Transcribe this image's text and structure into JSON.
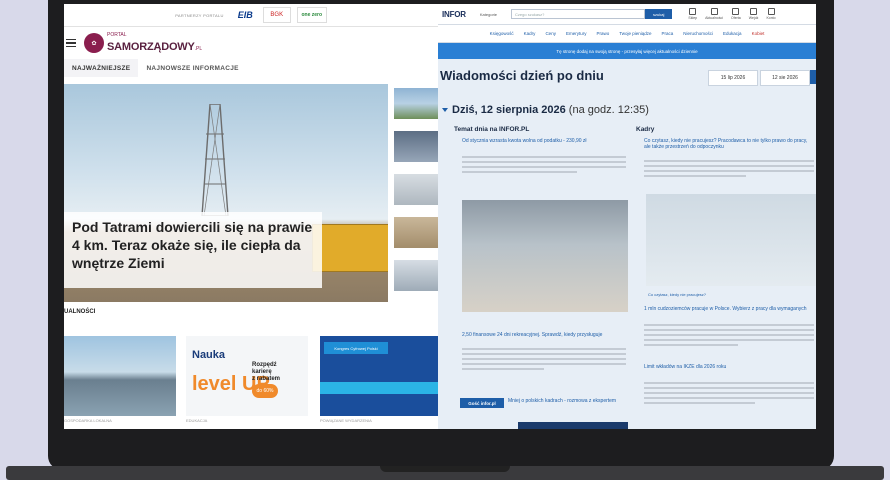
{
  "left_portal": {
    "ad_strip": {
      "label": "PARTNERZY PORTALU",
      "logos": [
        "EIB",
        "BGK",
        "one zero"
      ]
    },
    "brand": {
      "small": "PORTAL",
      "name": "SAMORZĄDOWY",
      "suffix": ".PL"
    },
    "tabs": [
      "NAJWAŻNIEJSZE",
      "NAJNOWSZE INFORMACJE"
    ],
    "hero_headline": "Pod Tatrami dowiercili się na prawie 4 km. Teraz okaże się, ile ciepła da wnętrze Ziemi",
    "section_label": "UALNOŚCI",
    "cards": [
      {
        "tag": "GOSPODARKA LOKALNA"
      },
      {
        "tag": "EDUKACJA",
        "title": "Nauka",
        "subtitle": "level UP",
        "badge_line1": "Rozpędź",
        "badge_line2": "karierę",
        "badge_line3": "z rabatem",
        "badge_pct": "do 60%"
      },
      {
        "tag": "POWIĄZANE WYDARZENIA",
        "band": "Kongres Cyfrowej Polski"
      }
    ]
  },
  "right_portal": {
    "logo": "INFOR",
    "catalog_label": "Kategorie",
    "search_placeholder": "Czego szukasz?",
    "search_button": "szukaj",
    "icons": [
      {
        "name": "phone-icon",
        "label": "Sklep"
      },
      {
        "name": "doc-icon",
        "label": "Aktualności"
      },
      {
        "name": "gift-icon",
        "label": "Oferta"
      },
      {
        "name": "book-icon",
        "label": "Wejdź"
      },
      {
        "name": "user-icon",
        "label": "Konto"
      }
    ],
    "nav": [
      "Księgowość",
      "Kadry",
      "Ceny",
      "Emerytury",
      "Prawo",
      "Twoje pieniądze",
      "Praca",
      "Nieruchomości",
      "Edukacja",
      "Kobiet"
    ],
    "banner": "Tę stronę dodaj na swoją stronę - przesyłaj więcej aktualności dziennie",
    "heading": "Wiadomości dzień po dniu",
    "date_from": "15 lip 2026",
    "date_to": "12 sie 2026",
    "today": "Dziś, 12 sierpnia 2026",
    "today_note": "(na godz. 12:35)",
    "col_left_title": "Temat dnia na INFOR.PL",
    "col_right_title": "Kadry",
    "left_link1": "Od stycznia wzrasta kwota wolna od podatku - 230,90 zł",
    "left_link2": "2,50 finansowe 24 dni rekreacyjnej. Sprawdź, kiedy przysługuje",
    "right_link1": "Co czytasz, kiedy nie pracujesz? Pracodawca to nie tylko prawo do pracy, ale także przestrzeń do odpoczynku",
    "right_caption": "Co czytasz, kiedy nie pracujesz?",
    "right_link2": "1 mln cudzoziemców pracuje w Polsce. Wybierz z pracy dla wymaganych",
    "right_link3": "Limit wkładów na IKZE dla 2026 roku",
    "guest_label": "Gość infor.pl",
    "guest_text": "Mniej o polskich kadrach - rozmowa z ekspertem"
  }
}
